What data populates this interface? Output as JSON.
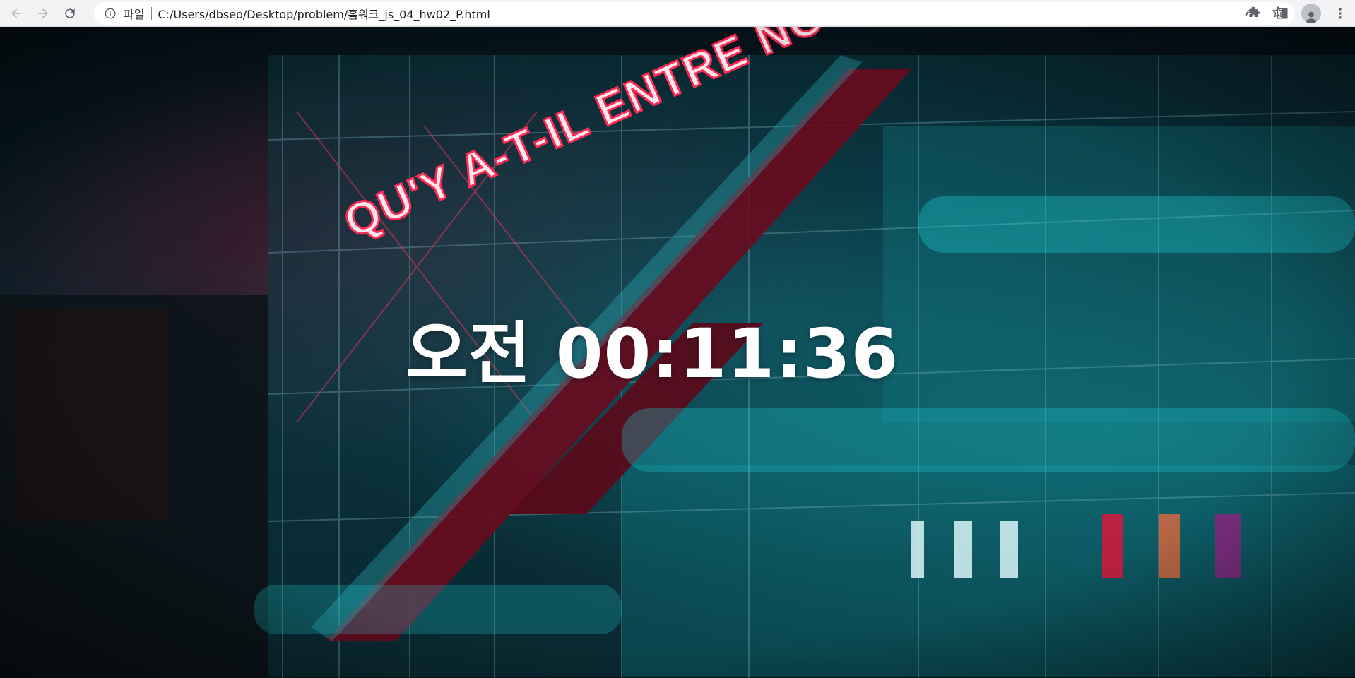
{
  "browser": {
    "scheme_label": "파일",
    "url": "C:/Users/dbseo/Desktop/problem/홈워크_js_04_hw02_P.html",
    "icons": {
      "back": "arrow-left-icon",
      "forward": "arrow-right-icon",
      "reload": "reload-icon",
      "info": "info-icon",
      "share": "share-icon",
      "bookmark": "star-icon",
      "extensions": "puzzle-icon",
      "side_panel": "side-panel-icon",
      "profile": "profile-avatar-icon",
      "menu": "kebab-menu-icon"
    }
  },
  "page": {
    "clock_text": "오전 00:11:36",
    "background_neon_sign": "QU'Y A-T-IL ENTRE NOUS?"
  },
  "colors": {
    "toolbar_bg": "#f1f3f4",
    "clock_text": "#ffffff",
    "neon_red": "#ff2a55",
    "teal_glow": "#22d3d8"
  }
}
